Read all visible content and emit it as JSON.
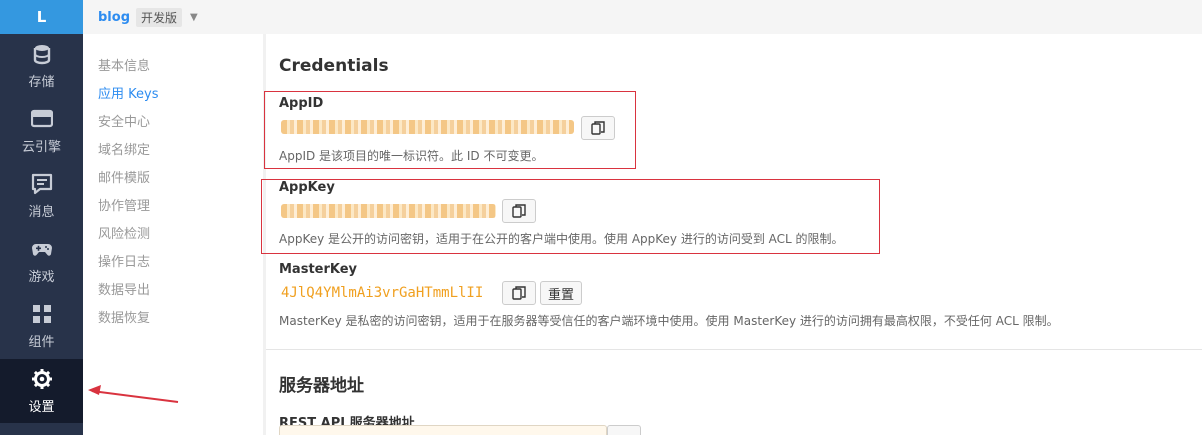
{
  "rail": {
    "logo": "L",
    "items": [
      {
        "label": "存储",
        "icon": "database-icon"
      },
      {
        "label": "云引擎",
        "icon": "cloud-engine-icon"
      },
      {
        "label": "消息",
        "icon": "message-icon"
      },
      {
        "label": "游戏",
        "icon": "gamepad-icon"
      },
      {
        "label": "组件",
        "icon": "components-icon"
      },
      {
        "label": "设置",
        "icon": "gear-icon",
        "active": true
      }
    ]
  },
  "topbar": {
    "app_name": "blog",
    "env": "开发版"
  },
  "subnav": {
    "items": [
      "基本信息",
      "应用 Keys",
      "安全中心",
      "域名绑定",
      "邮件模版",
      "协作管理",
      "风险检测",
      "操作日志",
      "数据导出",
      "数据恢复"
    ],
    "active": "应用 Keys"
  },
  "credentials": {
    "title": "Credentials",
    "appid": {
      "label": "AppID",
      "help": "AppID 是该项目的唯一标识符。此 ID 不可变更。"
    },
    "appkey": {
      "label": "AppKey",
      "help": "AppKey 是公开的访问密钥，适用于在公开的客户端中使用。使用 AppKey 进行的访问受到 ACL 的限制。"
    },
    "masterkey": {
      "label": "MasterKey",
      "value": "4JlQ4YMlmAi3vrGaHTmmLlII",
      "reset": "重置",
      "help": "MasterKey 是私密的访问密钥，适用于在服务器等受信任的客户端环境中使用。使用 MasterKey 进行的访问拥有最高权限，不受任何 ACL 限制。"
    }
  },
  "server": {
    "title": "服务器地址",
    "rest_label": "REST API 服务器地址"
  },
  "colors": {
    "accent": "#2d8cf0",
    "rail": "#28334a",
    "highlight": "#d9333f",
    "key": "#f0a020"
  }
}
